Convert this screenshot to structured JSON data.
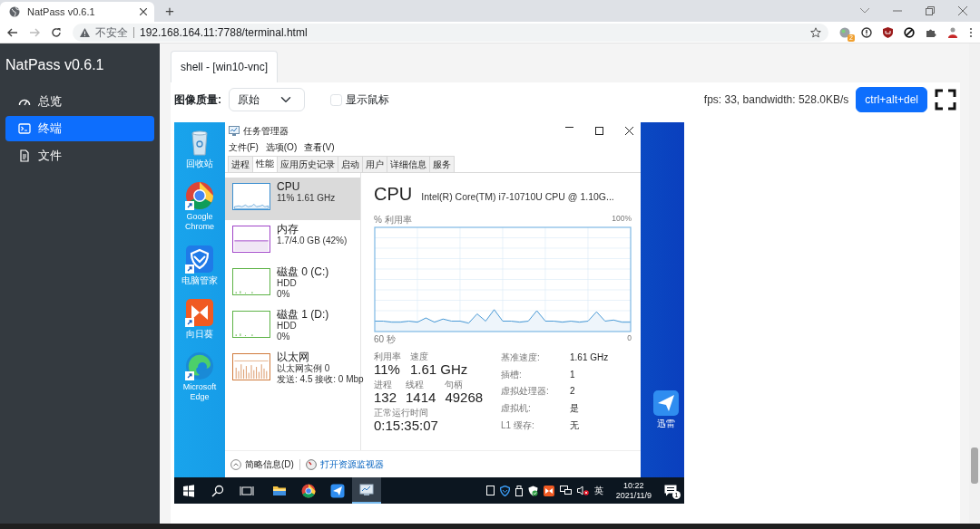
{
  "browser": {
    "tab_title": "NatPass v0.6.1",
    "new_tab": "+",
    "security": "不安全",
    "url": "192.168.164.11:7788/terminal.html",
    "extension_badge": "2"
  },
  "sidebar": {
    "brand": "NatPass v0.6.1",
    "items": [
      {
        "label": "总览",
        "selected": false
      },
      {
        "label": "终端",
        "selected": true
      },
      {
        "label": "文件",
        "selected": false
      }
    ]
  },
  "tabs": [
    {
      "label": "shell - [win10-vnc]",
      "selected": true
    }
  ],
  "toolbar": {
    "quality_label": "图像质量:",
    "quality_value": "原始",
    "show_cursor": {
      "label": "显示鼠标",
      "checked": false
    },
    "stats": "fps: 33, bandwidth: 528.0KB/s",
    "cad_button": "ctrl+alt+del"
  },
  "remote_desktop": {
    "desktop_icons": [
      {
        "label": "回收站"
      },
      {
        "label": "Google Chrome"
      },
      {
        "label": "电脑管家"
      },
      {
        "label": "向日葵"
      },
      {
        "label": "Microsoft Edge"
      }
    ],
    "right_icon": {
      "label": "迅雷"
    },
    "task_manager": {
      "title": "任务管理器",
      "menu": [
        "文件(F)",
        "选项(O)",
        "查看(V)"
      ],
      "tabs": [
        {
          "label": "进程",
          "selected": false
        },
        {
          "label": "性能",
          "selected": true
        },
        {
          "label": "应用历史记录",
          "selected": false
        },
        {
          "label": "启动",
          "selected": false
        },
        {
          "label": "用户",
          "selected": false
        },
        {
          "label": "详细信息",
          "selected": false
        },
        {
          "label": "服务",
          "selected": false
        }
      ],
      "resources": [
        {
          "kind": "cpu",
          "name": "CPU",
          "details": [
            "11% 1.61 GHz"
          ],
          "color": "#3c8fd0",
          "selected": true
        },
        {
          "kind": "memory",
          "name": "内存",
          "details": [
            "1.7/4.0 GB (42%)"
          ],
          "color": "#a044c8",
          "selected": false
        },
        {
          "kind": "disk",
          "name": "磁盘 0 (C:)",
          "details": [
            "HDD",
            "0%"
          ],
          "color": "#5db346",
          "selected": false
        },
        {
          "kind": "disk",
          "name": "磁盘 1 (D:)",
          "details": [
            "HDD",
            "0%"
          ],
          "color": "#5db346",
          "selected": false
        },
        {
          "kind": "network",
          "name": "以太网",
          "details": [
            "以太网实例 0",
            "发送: 4.5 接收: 0 Mbp"
          ],
          "color": "#d07a3c",
          "selected": false
        }
      ],
      "heading": "CPU",
      "model": "Intel(R) Core(TM) i7-10710U CPU @ 1.10G...",
      "usage_graph": {
        "label": "% 利用率",
        "max_label": "100%",
        "start_label": "60 秒",
        "end_label": "0"
      },
      "stats": [
        [
          {
            "label": "利用率",
            "value": "11%"
          },
          {
            "label": "速度",
            "value": "1.61 GHz"
          }
        ],
        [
          {
            "label": "进程",
            "value": "132"
          },
          {
            "label": "线程",
            "value": "1414"
          },
          {
            "label": "句柄",
            "value": "49268"
          }
        ],
        [
          {
            "label": "正常运行时间",
            "value": "0:15:35:07"
          }
        ]
      ],
      "specs": [
        {
          "label": "基准速度:",
          "value": "1.61 GHz"
        },
        {
          "label": "插槽:",
          "value": "1"
        },
        {
          "label": "虚拟处理器:",
          "value": "2"
        },
        {
          "label": "虚拟机:",
          "value": "是"
        },
        {
          "label": "L1 缓存:",
          "value": "无"
        }
      ],
      "fewer_details": "简略信息(D)",
      "open_monitor": "打开资源监视器"
    },
    "taskbar": {
      "apps": [
        {
          "selected": false
        },
        {
          "selected": false
        },
        {
          "selected": false
        },
        {
          "selected": false
        },
        {
          "selected": false
        },
        {
          "selected": false
        },
        {
          "selected": true
        }
      ],
      "ime": "英",
      "time": "10:22",
      "date": "2021/11/9",
      "notifications": "1"
    }
  }
}
